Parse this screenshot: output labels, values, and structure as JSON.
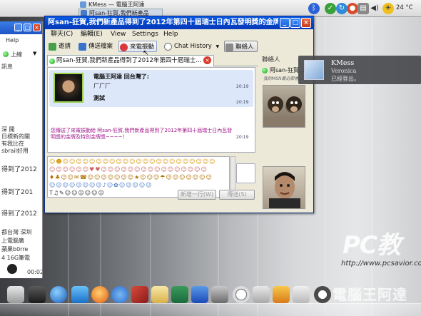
{
  "top_panel": {
    "task_active_title": "KMess — 電腦王阿達",
    "task_second_title": "阿san-狂賀,我們新產品",
    "clock": "24 °C",
    "tray_icons": [
      "bluetooth-icon",
      "network-icon",
      "update-icon",
      "volume-icon",
      "battery-icon",
      "weather-icon"
    ]
  },
  "left_window": {
    "menu_help": "Help",
    "button_up": "上線",
    "text_lines": [
      "訊息",
      "深 開",
      "日標新的開",
      "有我比在",
      "sbrail好用",
      "得到了2012",
      "得到了201",
      "得到了2012",
      "都台灣 深圳",
      "上電腦廣 ",
      "蘋果b0rre",
      "4 16G筆電",
      "00:02"
    ]
  },
  "window": {
    "title": "阿san-狂賀,我們新產品得到了2012年第四十屆瑞士日內瓦發明獎的金牌",
    "menu": [
      "聊天(C)",
      "編輯(E)",
      "View",
      "Settings",
      "Help"
    ],
    "toolbar": {
      "invite": "邀請",
      "send_file": "傳送檔案",
      "buzz": "來電振動",
      "chat_history": "Chat History",
      "contacts": "聯絡人"
    },
    "tab_label": "阿san-狂賀,我們新產品得到了2012年第四十屆瑞士...",
    "message": {
      "sender": "電腦王阿達 回台灣了:",
      "line1": "厂厂厂",
      "line2": "測試",
      "time1": "20:19",
      "time2": "20:19"
    },
    "buzz_notice": "您傳送了來電振動給 阿san-狂賀,我們新產品得到了2012年第四十屆瑞士日內瓦發明獎的金牌及特別金牌獎~~~~！",
    "buzz_time": "20:19",
    "emoticons": [
      "☺☻☹☺☺☺☺☺☺☺☺☺☺☺☺☺☺☺☺☺☺☺☺☺☺",
      "☺☺☺☺☺☺♥♥☺☺☺☺☺☺☺☺☺☺☺☺☺☺☺☺",
      "♦♣☺☺✉☎☺☺☺☺☺☺☺★☺☺☺☂☺☺☺☺☺☺☺",
      "☺☺☺☺☺☺☺☺♪☺✿☺☺☺☺☺",
      "T♫✎☺☺☺☺☺☺"
    ],
    "buttons": {
      "new_line": "新增一行(W)",
      "send": "傳送(S)"
    }
  },
  "sidebar": {
    "header": "聯絡人",
    "contact_name": "阿san-狂賀...",
    "contact_status": "我的MSN最近都會..."
  },
  "notification": {
    "app": "KMess",
    "name": "Veronica",
    "status": "已經登出。"
  },
  "branding": {
    "logo": "PC教",
    "url": "http://www.pcsavior.co",
    "watermark": "電腦王阿達"
  },
  "colors": {
    "titlebar": "#0042c8",
    "accent": "#9ad04a",
    "buzz_text": "#a0168a"
  }
}
